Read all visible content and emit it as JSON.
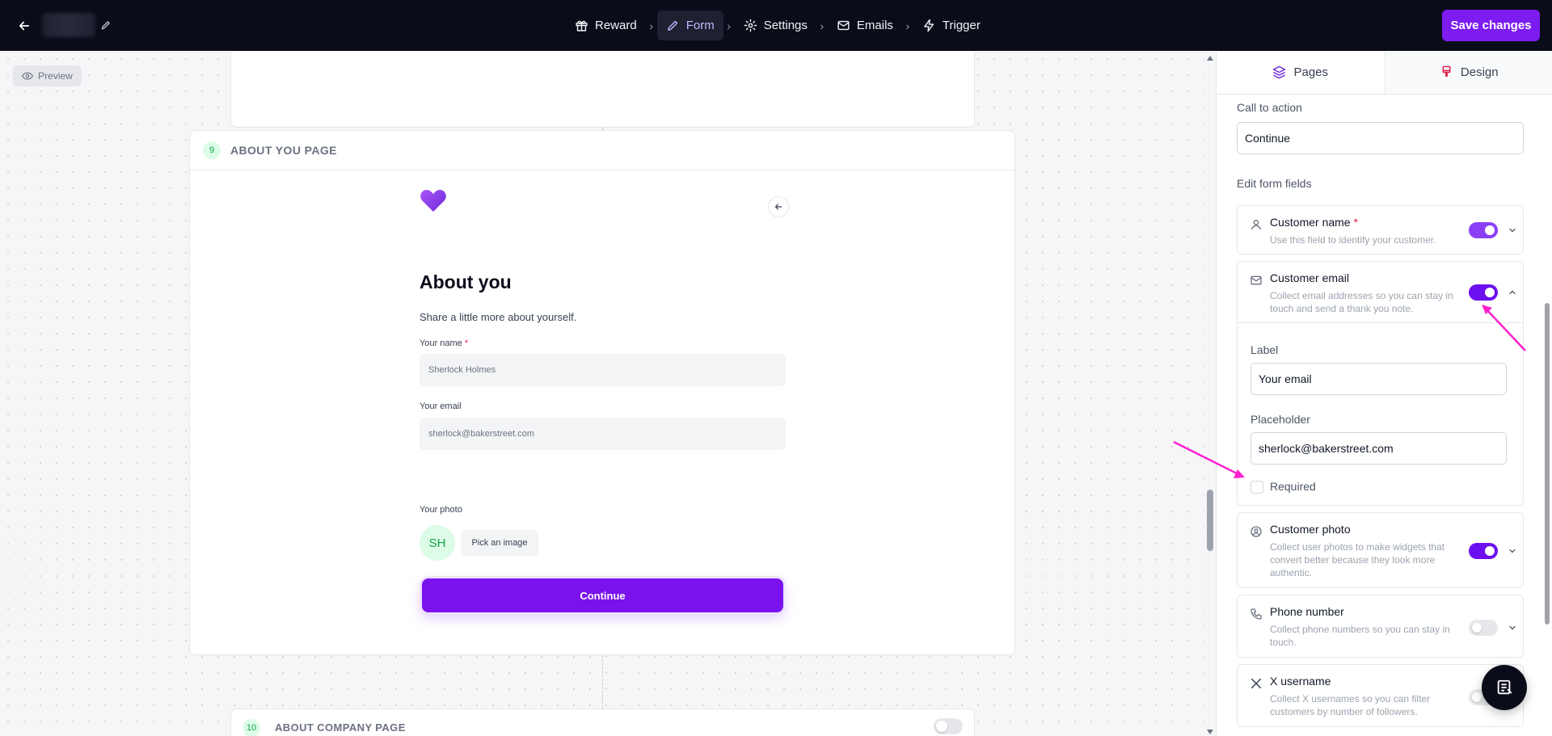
{
  "topbar": {
    "steps": [
      {
        "label": "Reward",
        "icon": "gift-icon"
      },
      {
        "label": "Form",
        "icon": "pencil-icon"
      },
      {
        "label": "Settings",
        "icon": "gear-icon"
      },
      {
        "label": "Emails",
        "icon": "mail-icon"
      },
      {
        "label": "Trigger",
        "icon": "bolt-icon"
      }
    ],
    "active_step": "Form",
    "save_label": "Save changes"
  },
  "canvas": {
    "preview_label": "Preview",
    "page9": {
      "number": "9",
      "title": "ABOUT YOU PAGE",
      "heading": "About you",
      "subheading": "Share a little more about yourself.",
      "name_label": "Your name",
      "name_required_mark": "*",
      "name_placeholder": "Sherlock Holmes",
      "email_label": "Your email",
      "email_placeholder": "sherlock@bakerstreet.com",
      "photo_label": "Your photo",
      "avatar_initials": "SH",
      "pick_image_label": "Pick an image",
      "continue_label": "Continue"
    },
    "page10": {
      "number": "10",
      "title": "ABOUT COMPANY PAGE",
      "enabled": false
    }
  },
  "panel": {
    "tabs": [
      {
        "label": "Pages",
        "icon": "layers-icon"
      },
      {
        "label": "Design",
        "icon": "brush-icon"
      }
    ],
    "cta_label": "Call to action",
    "cta_value": "Continue",
    "edit_fields_label": "Edit form fields",
    "fields": {
      "customer_name": {
        "title": "Customer name",
        "required_mark": "*",
        "desc": "Use this field to identify your customer.",
        "enabled": true
      },
      "customer_email": {
        "title": "Customer email",
        "desc": "Collect email addresses so you can stay in touch and send a thank you note.",
        "enabled": true,
        "expanded": true,
        "label_caption": "Label",
        "label_value": "Your email",
        "placeholder_caption": "Placeholder",
        "placeholder_value": "sherlock@bakerstreet.com",
        "required_label": "Required",
        "required": false
      },
      "customer_photo": {
        "title": "Customer photo",
        "desc": "Collect user photos to make widgets that convert better because they look more authentic.",
        "enabled": true
      },
      "phone_number": {
        "title": "Phone number",
        "desc": "Collect phone numbers so you can stay in touch.",
        "enabled": false
      },
      "x_username": {
        "title": "X username",
        "desc": "Collect X usernames so you can filter customers by number of followers.",
        "enabled": false
      }
    }
  },
  "colors": {
    "brand": "#7c1cf0",
    "topbar_bg": "#0b0c1a",
    "annotation_arrow": "#ff1fcf"
  }
}
